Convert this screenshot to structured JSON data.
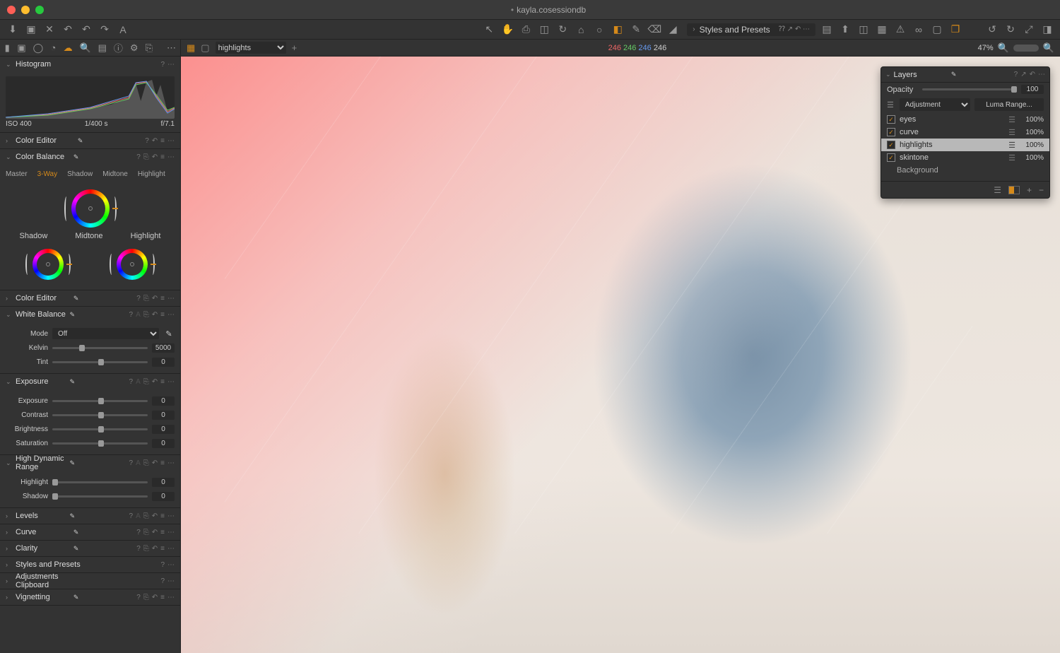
{
  "window": {
    "title": "kayla.cosessiondb"
  },
  "styles_bar": {
    "label": "Styles and Presets"
  },
  "viewbar": {
    "layer_select": "highlights",
    "rgb": {
      "r": "246",
      "g": "246",
      "b": "246",
      "w": "246"
    },
    "zoom": "47%"
  },
  "histogram": {
    "iso": "ISO 400",
    "shutter": "1/400 s",
    "aperture": "f/7.1"
  },
  "panels": {
    "histogram": "Histogram",
    "color_editor": "Color Editor",
    "color_balance": "Color Balance",
    "white_balance": "White Balance",
    "exposure": "Exposure",
    "hdr": "High Dynamic Range",
    "levels": "Levels",
    "curve": "Curve",
    "clarity": "Clarity",
    "styles": "Styles and Presets",
    "adj_clip": "Adjustments Clipboard",
    "vignetting": "Vignetting"
  },
  "color_balance": {
    "tabs": {
      "master": "Master",
      "three_way": "3-Way",
      "shadow": "Shadow",
      "midtone": "Midtone",
      "highlight": "Highlight"
    },
    "wheel_labels": {
      "shadow": "Shadow",
      "midtone": "Midtone",
      "highlight": "Highlight"
    }
  },
  "white_balance": {
    "mode_label": "Mode",
    "mode_value": "Off",
    "kelvin_label": "Kelvin",
    "kelvin_value": "5000",
    "tint_label": "Tint",
    "tint_value": "0"
  },
  "exposure": {
    "exposure_label": "Exposure",
    "exposure_value": "0",
    "contrast_label": "Contrast",
    "contrast_value": "0",
    "brightness_label": "Brightness",
    "brightness_value": "0",
    "saturation_label": "Saturation",
    "saturation_value": "0"
  },
  "hdr": {
    "highlight_label": "Highlight",
    "highlight_value": "0",
    "shadow_label": "Shadow",
    "shadow_value": "0"
  },
  "layers_panel": {
    "title": "Layers",
    "opacity_label": "Opacity",
    "opacity_value": "100",
    "type_value": "Adjustment",
    "luma_button": "Luma Range...",
    "layers": [
      {
        "name": "eyes",
        "pct": "100%"
      },
      {
        "name": "curve",
        "pct": "100%"
      },
      {
        "name": "highlights",
        "pct": "100%"
      },
      {
        "name": "skintone",
        "pct": "100%"
      }
    ],
    "background": "Background"
  }
}
